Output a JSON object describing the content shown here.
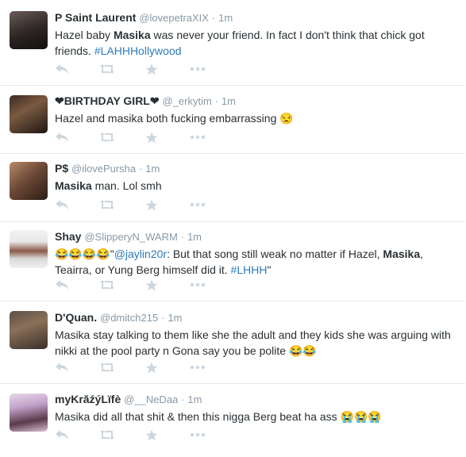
{
  "tweets": [
    {
      "name": "P Saint Laurent",
      "handle": "@lovepetraXIX",
      "time": "1m",
      "seg": [
        "Hazel baby ",
        "Masika",
        " was never your friend. In fact I don't think that chick got friends. ",
        "#LAHHHollywood"
      ],
      "emoji": ""
    },
    {
      "name": "❤BIRTHDAY GIRL❤",
      "handle": "@_erkytim",
      "time": "1m",
      "seg": [
        "Hazel and masika both fucking embarrassing "
      ],
      "emoji": "😒"
    },
    {
      "name": "P$",
      "handle": "@ilovePursha",
      "time": "1m",
      "seg": [
        "Masika",
        " man. Lol smh"
      ],
      "emoji": ""
    },
    {
      "name": "Shay",
      "handle": "@SlipperyN_WARM",
      "time": "1m",
      "seg": [
        "😂😂😂😂\"",
        "@jaylin20r",
        ": But that song still weak no matter if Hazel, ",
        "Masika",
        ", Teairra, or Yung Berg himself did it. ",
        "#LHHH",
        "\""
      ],
      "emoji": ""
    },
    {
      "name": "D'Quan.",
      "handle": "@dmitch215",
      "time": "1m",
      "seg": [
        "Masika stay talking to them like she the adult and they kids she was arguing with nikki at the pool party n Gona say you be polite "
      ],
      "emoji": "😂😂"
    },
    {
      "name": "myKrăźýLïfè",
      "handle": "@__NeDaa",
      "time": "1m",
      "seg": [
        "Masika did all that shit & then this nigga Berg beat ha ass "
      ],
      "emoji": "😭😭😭"
    }
  ],
  "separator": "·",
  "actions": [
    "reply-icon",
    "retweet-icon",
    "favorite-icon",
    "more-icon"
  ],
  "colors": {
    "name": "#292f33",
    "meta": "#8899a6",
    "link": "#2b7bb9",
    "icon": "#ccd6dd",
    "divider": "#e1e8ed"
  }
}
